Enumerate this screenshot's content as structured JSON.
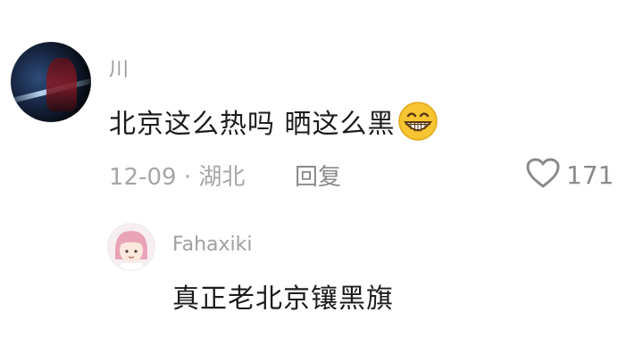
{
  "comment": {
    "username": "川",
    "text": "北京这么热吗 晒这么黑",
    "emoji_icon": "grinning-face-icon",
    "meta": "12-09 · 湖北",
    "reply_label": "回复",
    "like_icon": "heart-outline-icon",
    "like_count": "171"
  },
  "reply": {
    "username": "Fahaxiki",
    "text": "真正老北京镶黑旗"
  },
  "colors": {
    "text_primary": "#1c1c1c",
    "text_secondary": "#9a9a9a",
    "emoji_face": "#f7c531"
  }
}
